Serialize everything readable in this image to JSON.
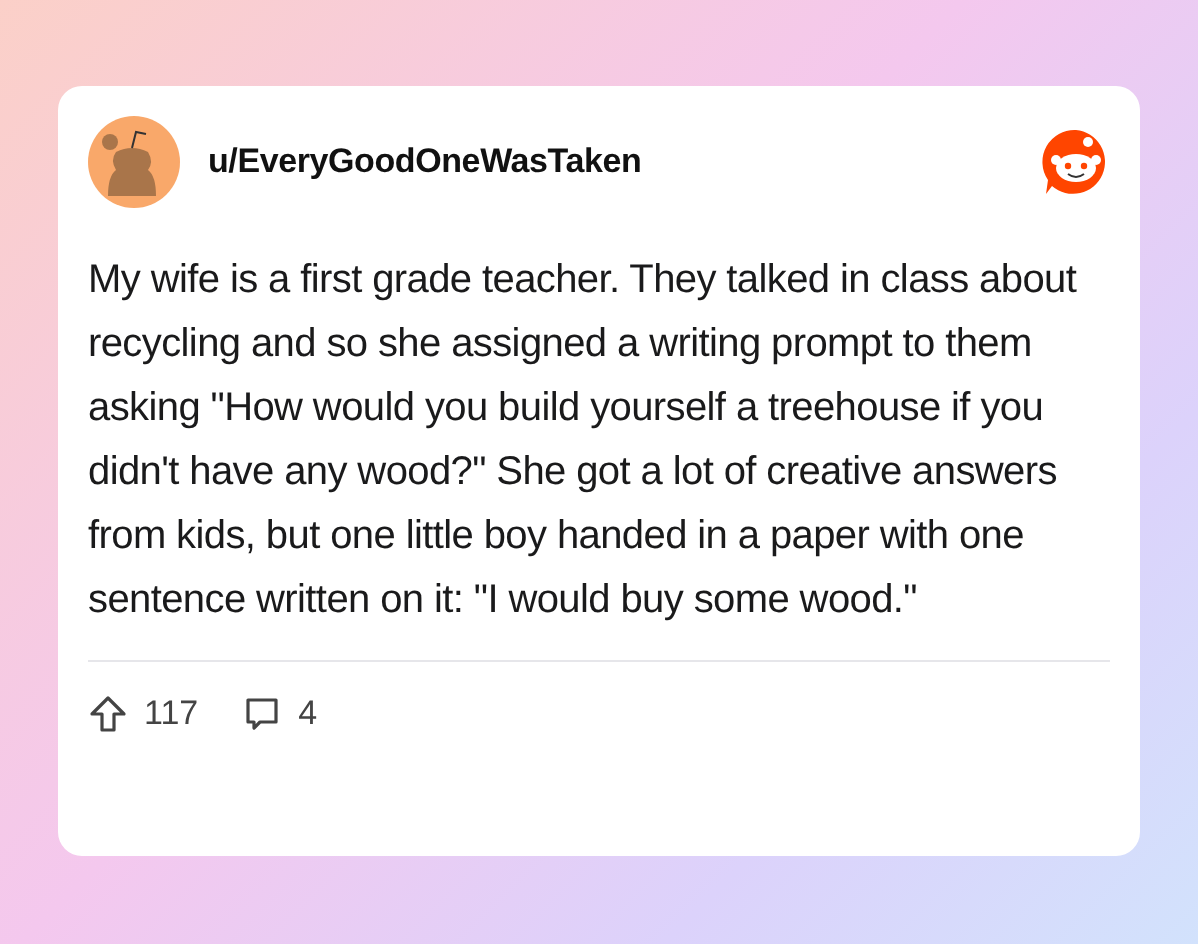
{
  "post": {
    "username": "u/EveryGoodOneWasTaken",
    "body": "My wife is a first grade teacher. They talked in class about recycling and so she assigned a writing prompt to them asking \"How would you build yourself a treehouse if you didn't have any wood?\" She got a lot of creative answers from kids, but one little boy handed in a paper with one sentence written on it: \"I would buy some wood.\"",
    "upvotes": "117",
    "comments": "4"
  }
}
